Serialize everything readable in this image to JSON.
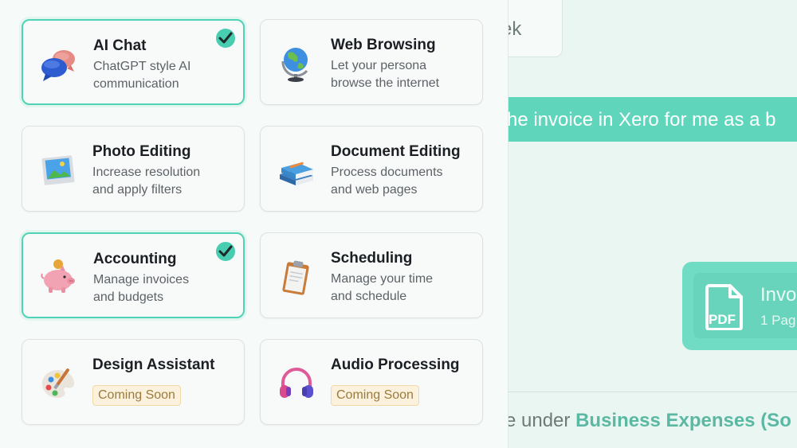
{
  "features": [
    {
      "title": "AI Chat",
      "desc_line1": "ChatGPT style AI",
      "desc_line2": "communication",
      "selected": true,
      "icon": "chat-bubbles-icon"
    },
    {
      "title": "Web Browsing",
      "desc_line1": "Let your persona",
      "desc_line2": "browse the internet",
      "selected": false,
      "icon": "globe-icon"
    },
    {
      "title": "Photo Editing",
      "desc_line1": "Increase resolution",
      "desc_line2": "and apply filters",
      "selected": false,
      "icon": "photo-icon"
    },
    {
      "title": "Document Editing",
      "desc_line1": "Process documents",
      "desc_line2": "and web pages",
      "selected": false,
      "icon": "books-icon"
    },
    {
      "title": "Accounting",
      "desc_line1": "Manage invoices",
      "desc_line2": "and budgets",
      "selected": true,
      "icon": "piggy-bank-icon"
    },
    {
      "title": "Scheduling",
      "desc_line1": "Manage your time",
      "desc_line2": "and schedule",
      "selected": false,
      "icon": "clipboard-icon"
    },
    {
      "title": "Design Assistant",
      "badge": "Coming Soon",
      "selected": false,
      "icon": "palette-icon"
    },
    {
      "title": "Audio Processing",
      "badge": "Coming Soon",
      "selected": false,
      "icon": "headphones-icon"
    }
  ],
  "background": {
    "top_card_text": "ek",
    "message_text": "he invoice in Xero for me as a b",
    "file_name": "Invo",
    "file_pages": "1 Pag",
    "file_type": "PDF",
    "bottom_text_prefix": "e under ",
    "bottom_text_bold": "Business Expenses (So"
  },
  "colors": {
    "accent": "#4fd2b5",
    "message_bg": "#5fd6bb",
    "badge_bg": "#fbf1dc",
    "badge_text": "#9b7b3d"
  }
}
